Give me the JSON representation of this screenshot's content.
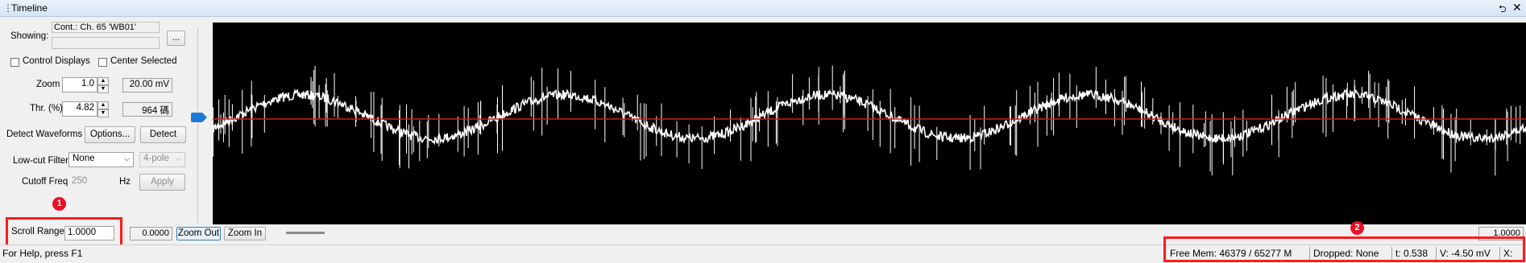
{
  "window": {
    "title": "Timeline",
    "pin_glyph": "⮌",
    "close_glyph": "✕",
    "grip_glyph": "⋮"
  },
  "controls": {
    "showing_label": "Showing:",
    "showing_value": "Cont.: Ch. 65 'WB01'",
    "showing_value2": "",
    "browse_label": "...",
    "control_displays_label": "Control Displays",
    "center_selected_label": "Center Selected",
    "zoom_label": "Zoom",
    "zoom_value": "1.0",
    "zoom_readout": "20.00 mV",
    "thr_label": "Thr. (%)",
    "thr_value": "4.82",
    "thr_readout": "964 碼",
    "detect_waveforms_label": "Detect Waveforms",
    "options_label": "Options...",
    "detect_label": "Detect",
    "lowcut_label": "Low-cut Filter",
    "lowcut_value": "None",
    "pole_value": "4-pole",
    "cutoff_label": "Cutoff Freq",
    "cutoff_value": "250",
    "hz_label": "Hz",
    "apply_label": "Apply",
    "scroll_range_label": "Scroll Range",
    "scroll_range_value": "1.0000"
  },
  "navigation": {
    "start_value": "0.0000",
    "zoom_out_label": "Zoom Out",
    "zoom_in_label": "Zoom In",
    "end_value": "1.0000"
  },
  "annotations": {
    "badge1": "1",
    "badge2": "2"
  },
  "status": {
    "help_text": "For Help, press F1",
    "free_mem": "Free Mem: 46379 / 65277 M",
    "dropped": "Dropped: None",
    "t": "t: 0.538",
    "v": "V: -4.50 mV",
    "x": "X:"
  },
  "colors": {
    "trace": "#ffffff",
    "threshold_line": "#d41a1a",
    "marker": "#1e78d7",
    "highlight_box": "#ff1a1a",
    "plot_background": "#000000"
  }
}
